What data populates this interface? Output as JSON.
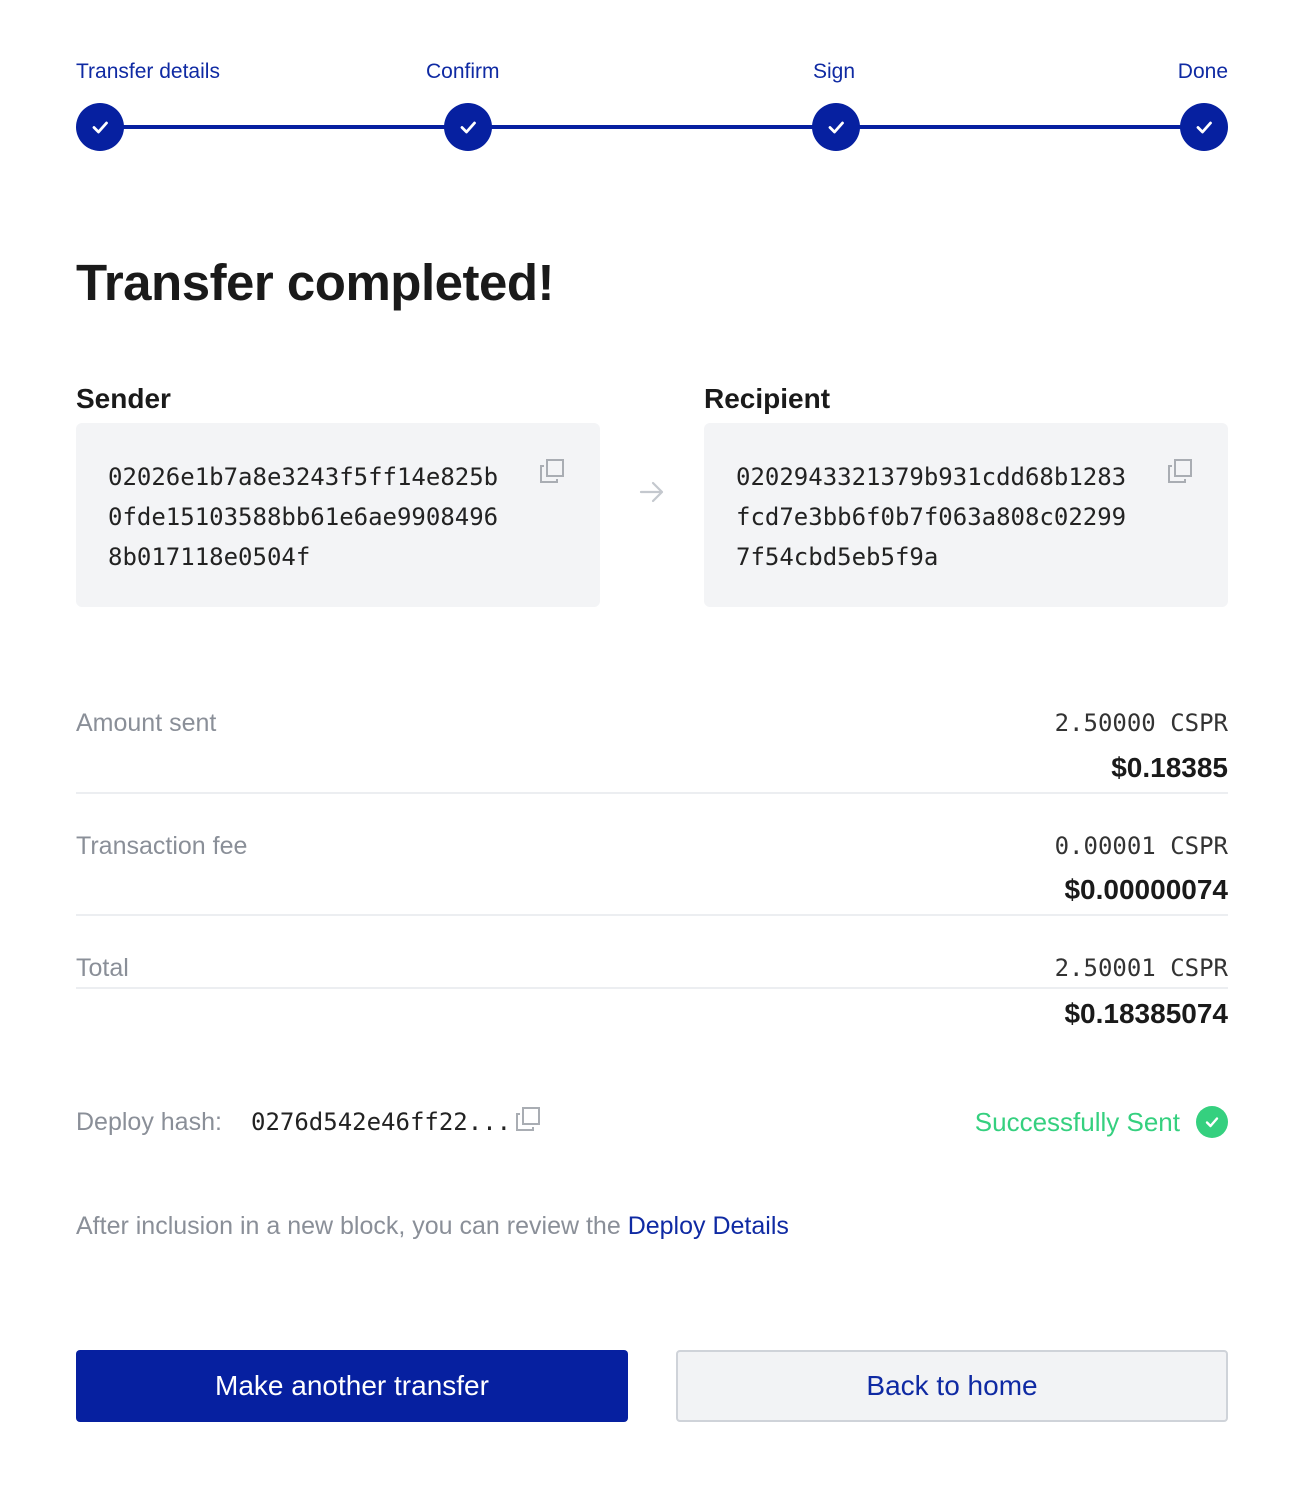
{
  "stepper": {
    "steps": [
      {
        "label": "Transfer details"
      },
      {
        "label": "Confirm"
      },
      {
        "label": "Sign"
      },
      {
        "label": "Done"
      }
    ]
  },
  "title": "Transfer completed!",
  "sender": {
    "label": "Sender",
    "public_key": "02026e1b7a8e3243f5ff14e825b0fde15103588bb61e6ae99084968b017118e0504f"
  },
  "recipient": {
    "label": "Recipient",
    "public_key": "0202943321379b931cdd68b1283fcd7e3bb6f0b7f063a808c022997f54cbd5eb5f9a"
  },
  "summary": {
    "amount_sent": {
      "label": "Amount sent",
      "cspr": "2.50000 CSPR",
      "usd": "$0.18385"
    },
    "transaction_fee": {
      "label": "Transaction fee",
      "cspr": "0.00001 CSPR",
      "usd": "$0.00000074"
    },
    "total": {
      "label": "Total",
      "cspr": "2.50001 CSPR",
      "usd": "$0.18385074"
    }
  },
  "deploy": {
    "hash_label": "Deploy hash:",
    "hash_value": "0276d542e46ff22...",
    "status": "Successfully Sent"
  },
  "note": {
    "text": "After inclusion in a new block, you can review the ",
    "link": "Deploy Details"
  },
  "buttons": {
    "primary": "Make another transfer",
    "secondary": "Back to home"
  },
  "colors": {
    "accent": "#0620a0",
    "link": "#0f2aa3",
    "success": "#35d07f",
    "muted": "#8a8f98",
    "box_bg": "#f3f4f6"
  },
  "icons": {
    "step": "check-icon",
    "copy": "copy-icon",
    "direction": "arrow-right-icon",
    "status": "check-circle-icon"
  }
}
